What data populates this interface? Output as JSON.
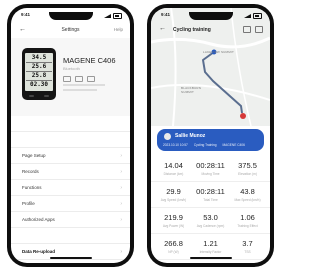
{
  "left_phone": {
    "status_time": "9:41",
    "nav_title": "Settings",
    "nav_action": "Help",
    "device": {
      "name": "MAGENE C406",
      "subtitle": "Bluetooth",
      "screen_rows": [
        "34.5",
        "25.6",
        "25.8",
        "02.30"
      ]
    },
    "menu": [
      {
        "label": "Page Setup"
      },
      {
        "label": "Records"
      },
      {
        "label": "Functions"
      },
      {
        "label": "Profile"
      },
      {
        "label": "Authorized Apps"
      },
      {
        "label": "Data Re-upload"
      }
    ]
  },
  "right_phone": {
    "status_time": "9:41",
    "title": "Cycling training",
    "map_labels": [
      "LAKEVIEW SUMMIT",
      "BLACKBURN SUMMIT"
    ],
    "route_card": {
      "name": "Sallie Munoz",
      "meta": [
        "2023.10.10 10:57",
        "Cycling Training",
        "MAGENE C406"
      ]
    },
    "stats": [
      [
        {
          "value": "14.04",
          "label": "Distance (km)"
        },
        {
          "value": "00:28:11",
          "label": "Moving Time"
        },
        {
          "value": "375.5",
          "label": "Elevation (m)"
        }
      ],
      [
        {
          "value": "29.9",
          "label": "Avg Speed (km/h)"
        },
        {
          "value": "00:28:11",
          "label": "Total Time"
        },
        {
          "value": "43.8",
          "label": "Max Speed (km/h)"
        }
      ],
      [
        {
          "value": "219.9",
          "label": "Avg Power (W)"
        },
        {
          "value": "53.0",
          "label": "Avg Cadence (rpm)"
        },
        {
          "value": "1.06",
          "label": "Training Effect"
        }
      ],
      [
        {
          "value": "266.8",
          "label": "NP (W)"
        },
        {
          "value": "1.21",
          "label": "Intensity Factor"
        },
        {
          "value": "3.7",
          "label": "TSS"
        }
      ]
    ]
  },
  "colors": {
    "accent_blue": "#2a5cc0",
    "route_line": "#5a6e8f",
    "marker_red": "#d63a3a"
  }
}
